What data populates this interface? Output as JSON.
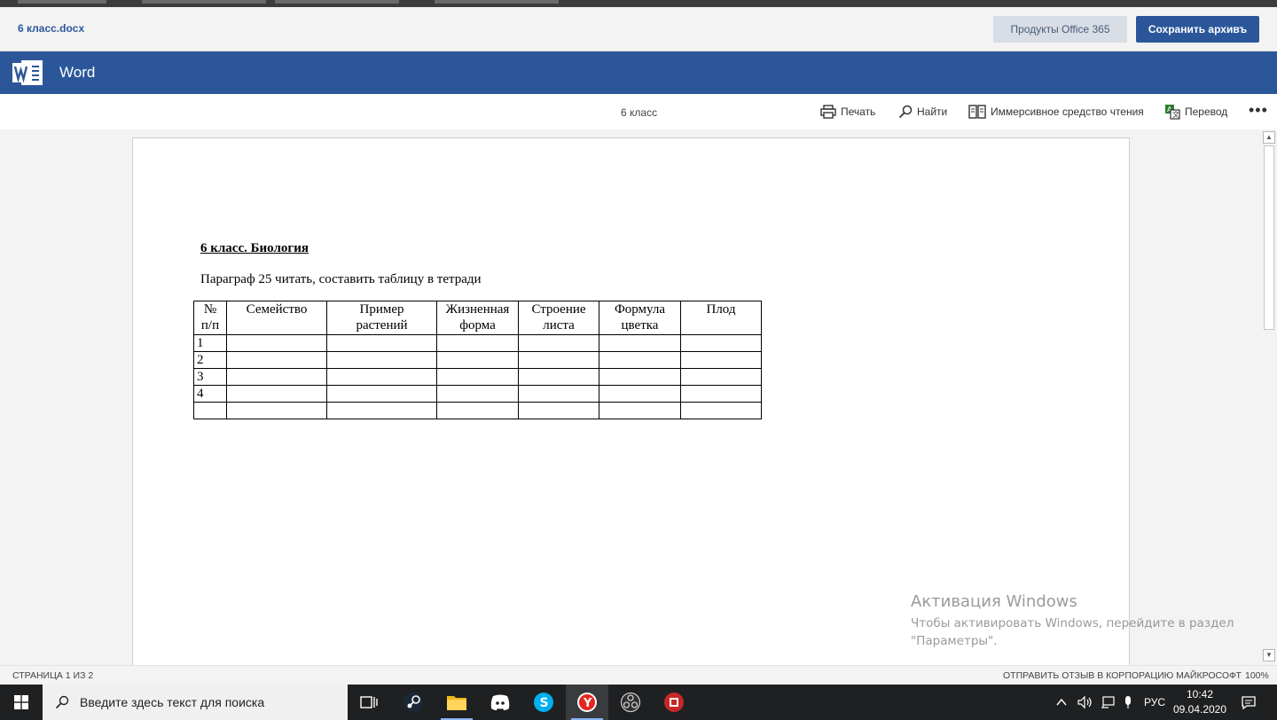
{
  "header": {
    "file_name": "6 класс.docx",
    "office_button": "Продукты Office 365",
    "save_button": "Сохранить архивъ"
  },
  "word_bar": {
    "app_name": "Word"
  },
  "toolbar": {
    "doc_title": "6 класс",
    "print": "Печать",
    "find": "Найти",
    "immersive": "Иммерсивное средство чтения",
    "translate": "Перевод",
    "more": "•••"
  },
  "document": {
    "heading": "6 класс. Биология",
    "paragraph": "Параграф 25 читать, составить таблицу в тетради",
    "table": {
      "headers": [
        "№\nп/п",
        "Семейство",
        "Пример\nрастений",
        "Жизненная\nформа",
        "Строение\nлиста",
        "Формула\nцветка",
        "Плод"
      ],
      "row_numbers": [
        "1",
        "2",
        "3",
        "4",
        ""
      ]
    }
  },
  "watermark": {
    "title": "Активация Windows",
    "subtitle": "Чтобы активировать Windows, перейдите в раздел \"Параметры\"."
  },
  "statusbar": {
    "page_info": "СТРАНИЦА 1 ИЗ 2",
    "feedback": "ОТПРАВИТЬ ОТЗЫВ В КОРПОРАЦИЮ МАЙКРОСОФТ",
    "zoom": "100%"
  },
  "taskbar": {
    "search_placeholder": "Введите здесь текст для поиска",
    "language": "РУС",
    "time": "10:42",
    "date": "09.04.2020"
  },
  "colors": {
    "word_blue": "#2b579a",
    "taskbar": "#1f2022"
  }
}
